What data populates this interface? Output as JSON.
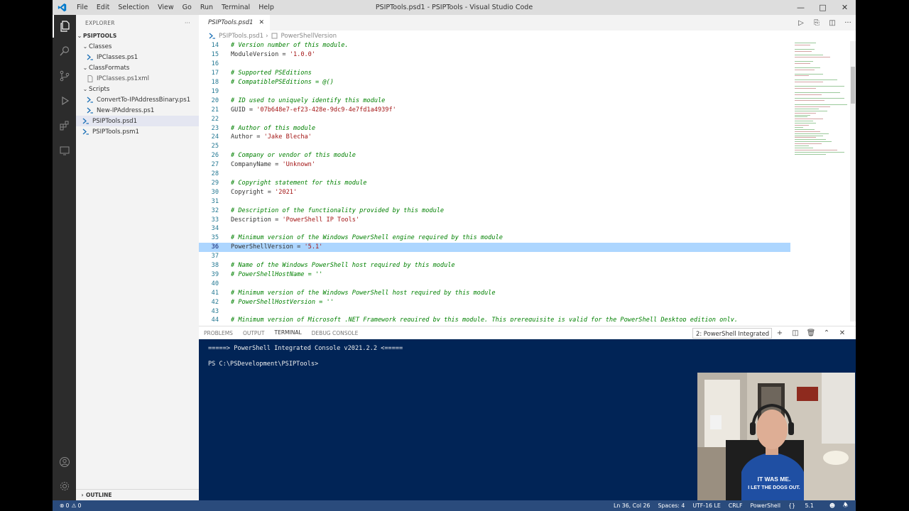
{
  "window": {
    "title": "PSIPTools.psd1 - PSIPTools - Visual Studio Code",
    "menu": [
      "File",
      "Edit",
      "Selection",
      "View",
      "Go",
      "Run",
      "Terminal",
      "Help"
    ]
  },
  "explorer": {
    "header": "EXPLORER",
    "more": "···",
    "root": "PSIPTOOLS",
    "items": [
      {
        "label": "Classes",
        "depth": 1,
        "type": "folder"
      },
      {
        "label": "IPClasses.ps1",
        "depth": 2,
        "type": "ps1"
      },
      {
        "label": "ClassFormats",
        "depth": 1,
        "type": "folder"
      },
      {
        "label": "IPClasses.ps1xml",
        "depth": 2,
        "type": "xml"
      },
      {
        "label": "Scripts",
        "depth": 1,
        "type": "folder"
      },
      {
        "label": "ConvertTo-IPAddressBinary.ps1",
        "depth": 2,
        "type": "ps1"
      },
      {
        "label": "New-IPAddress.ps1",
        "depth": 2,
        "type": "ps1"
      },
      {
        "label": "PSIPTools.psd1",
        "depth": 1,
        "type": "ps1",
        "selected": true
      },
      {
        "label": "PSIPTools.psm1",
        "depth": 1,
        "type": "ps1"
      }
    ],
    "outline": "OUTLINE"
  },
  "editor": {
    "tab": "PSIPTools.psd1",
    "breadcrumb": [
      "PSIPTools.psd1",
      "PowerShellVersion"
    ],
    "current_line": 36,
    "lines": [
      {
        "n": "14",
        "kind": "comment",
        "text": "# Version number of this module."
      },
      {
        "n": "15",
        "kind": "assign",
        "key": "ModuleVersion = ",
        "val": "'1.0.0'"
      },
      {
        "n": "16",
        "kind": "blank",
        "text": ""
      },
      {
        "n": "17",
        "kind": "comment",
        "text": "# Supported PSEditions"
      },
      {
        "n": "18",
        "kind": "comment",
        "text": "# CompatiblePSEditions = @()"
      },
      {
        "n": "19",
        "kind": "blank",
        "text": ""
      },
      {
        "n": "20",
        "kind": "comment",
        "text": "# ID used to uniquely identify this module"
      },
      {
        "n": "21",
        "kind": "assign",
        "key": "GUID = ",
        "val": "'07b648e7-ef23-428e-9dc9-4e7fd1a4939f'"
      },
      {
        "n": "22",
        "kind": "blank",
        "text": ""
      },
      {
        "n": "23",
        "kind": "comment",
        "text": "# Author of this module"
      },
      {
        "n": "24",
        "kind": "assign",
        "key": "Author = ",
        "val": "'Jake Blecha'"
      },
      {
        "n": "25",
        "kind": "blank",
        "text": ""
      },
      {
        "n": "26",
        "kind": "comment",
        "text": "# Company or vendor of this module"
      },
      {
        "n": "27",
        "kind": "assign",
        "key": "CompanyName = ",
        "val": "'Unknown'"
      },
      {
        "n": "28",
        "kind": "blank",
        "text": ""
      },
      {
        "n": "29",
        "kind": "comment",
        "text": "# Copyright statement for this module"
      },
      {
        "n": "30",
        "kind": "assign",
        "key": "Copyright = ",
        "val": "'2021'"
      },
      {
        "n": "31",
        "kind": "blank",
        "text": ""
      },
      {
        "n": "32",
        "kind": "comment",
        "text": "# Description of the functionality provided by this module"
      },
      {
        "n": "33",
        "kind": "assign",
        "key": "Description = ",
        "val": "'PowerShell IP Tools'"
      },
      {
        "n": "34",
        "kind": "blank",
        "text": ""
      },
      {
        "n": "35",
        "kind": "comment",
        "text": "# Minimum version of the Windows PowerShell engine required by this module"
      },
      {
        "n": "36",
        "kind": "assign",
        "key": "PowerShellVersion = ",
        "val": "'5.1'"
      },
      {
        "n": "37",
        "kind": "blank",
        "text": ""
      },
      {
        "n": "38",
        "kind": "comment",
        "text": "# Name of the Windows PowerShell host required by this module"
      },
      {
        "n": "39",
        "kind": "comment",
        "text": "# PowerShellHostName = ''"
      },
      {
        "n": "40",
        "kind": "blank",
        "text": ""
      },
      {
        "n": "41",
        "kind": "comment",
        "text": "# Minimum version of the Windows PowerShell host required by this module"
      },
      {
        "n": "42",
        "kind": "comment",
        "text": "# PowerShellHostVersion = ''"
      },
      {
        "n": "43",
        "kind": "blank",
        "text": ""
      },
      {
        "n": "44",
        "kind": "comment",
        "text": "# Minimum version of Microsoft .NET Framework required by this module. This prerequisite is valid for the PowerShell Desktop edition only."
      }
    ]
  },
  "panel": {
    "tabs": [
      "PROBLEMS",
      "OUTPUT",
      "TERMINAL",
      "DEBUG CONSOLE"
    ],
    "active_tab": "TERMINAL",
    "terminal_select": "2: PowerShell Integrated",
    "terminal_lines": [
      "=====> PowerShell Integrated Console v2021.2.2 <=====",
      "",
      "PS C:\\PSDevelopment\\PSIPTools>"
    ]
  },
  "status": {
    "errors": "0",
    "warnings": "0",
    "position": "Ln 36, Col 26",
    "spaces": "Spaces: 4",
    "encoding": "UTF-16 LE",
    "eol": "CRLF",
    "language": "PowerShell",
    "ps_version": "5.1"
  },
  "webcam": {
    "shirt_text_1": "IT WAS ME.",
    "shirt_text_2": "I LET THE DOGS OUT."
  },
  "colors": {
    "activity_bar": "#2c2c2c",
    "sidebar": "#f3f3f3",
    "terminal_bg": "#012456",
    "status_bar": "#2a4b7c",
    "line_highlight": "#add6ff",
    "comment": "#008000",
    "string": "#a31515"
  }
}
